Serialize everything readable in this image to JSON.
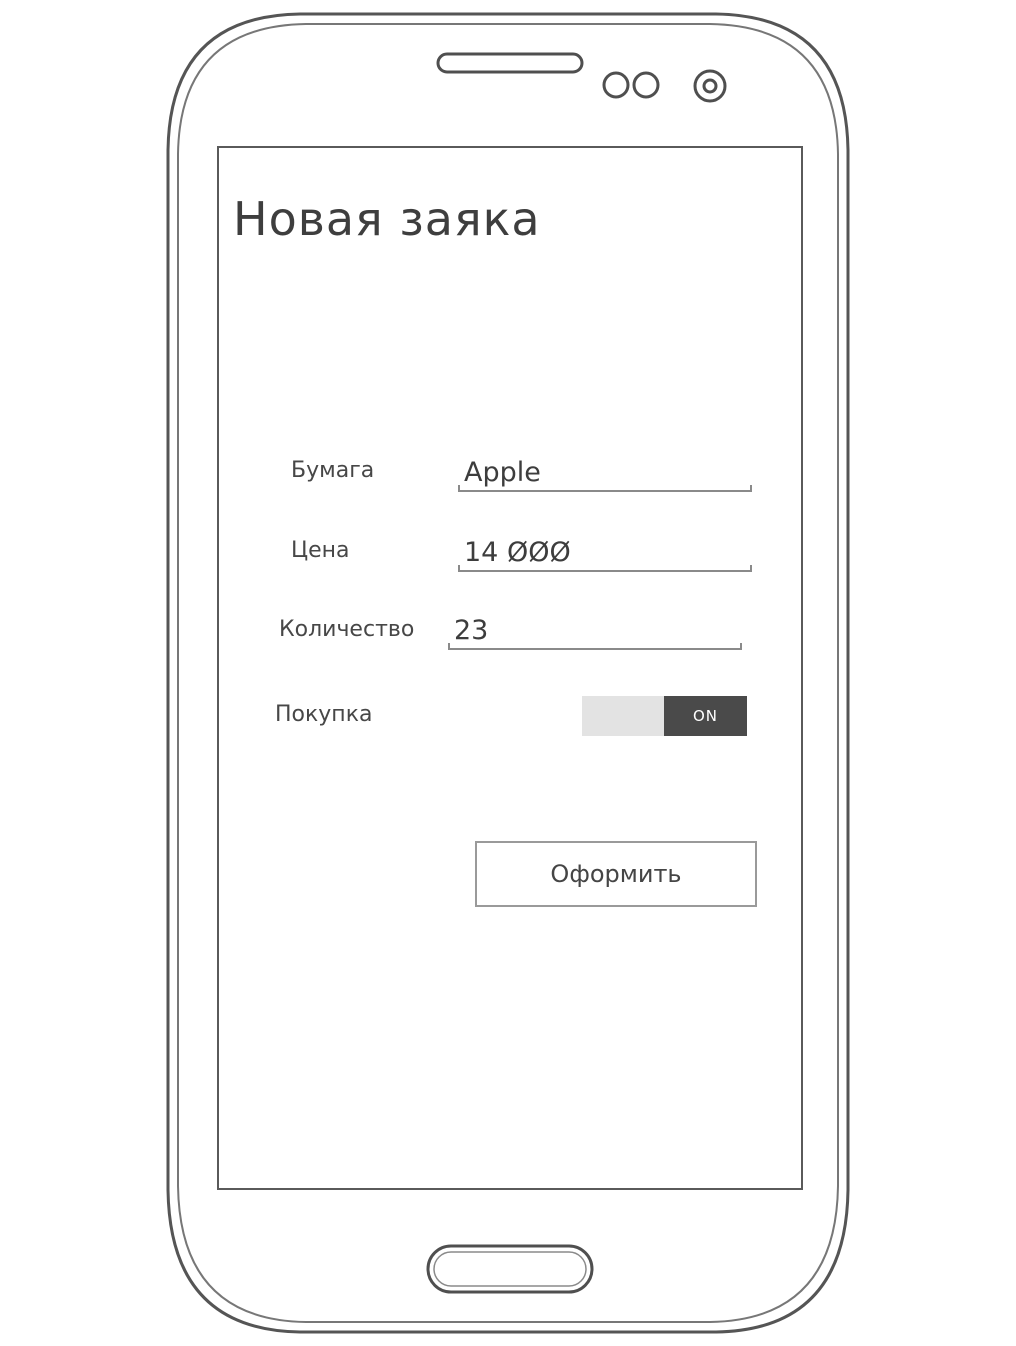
{
  "screen": {
    "title": "Новая заяка"
  },
  "form": {
    "fields": [
      {
        "label": "Бумага",
        "value": "Apple"
      },
      {
        "label": "Цена",
        "value": "14 ØØØ"
      },
      {
        "label": "Количество",
        "value": "23"
      }
    ],
    "purchase": {
      "label": "Покупка",
      "toggle_state": "ON"
    },
    "submit_label": "Оформить"
  },
  "colors": {
    "outline": "#5a5a5a",
    "toggle_on": "#4a4a4a",
    "toggle_off": "#e3e3e3"
  },
  "icons": [
    "earpiece-speaker",
    "sensor-icon",
    "front-camera-icon",
    "home-button"
  ]
}
